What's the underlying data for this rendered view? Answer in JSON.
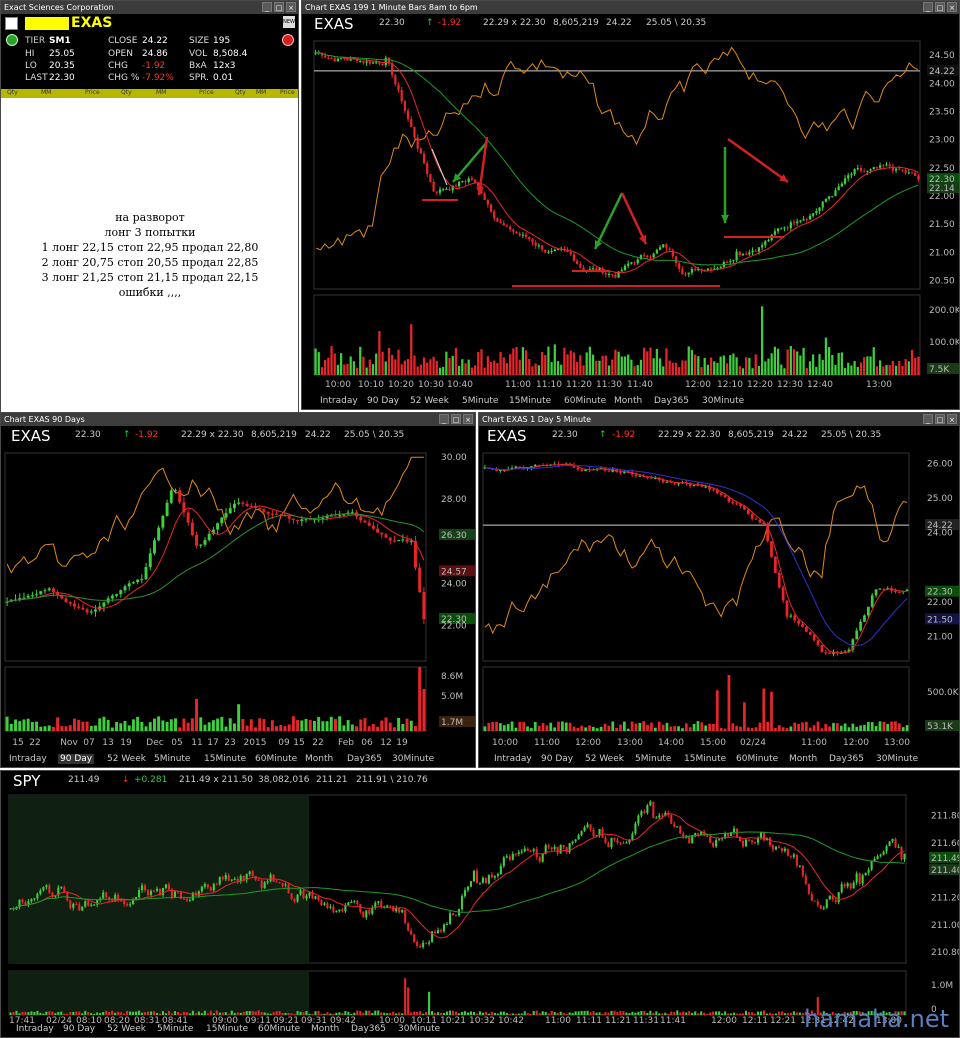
{
  "quote_window": {
    "title": "Exact Sciences Corporation",
    "symbol": "EXAS",
    "fields": {
      "tier_label": "TIER",
      "tier": "SM1",
      "hi_label": "HI",
      "hi": "25.05",
      "lo_label": "LO",
      "lo": "20.35",
      "last_label": "LAST",
      "last": "22.30",
      "close_label": "CLOSE",
      "close": "24.22",
      "open_label": "OPEN",
      "open": "24.86",
      "chg_label": "CHG",
      "chg": "-1.92",
      "chgp_label": "CHG %",
      "chgp": "-7.92%",
      "size_label": "SIZE",
      "size": "195",
      "vol_label": "VOL",
      "vol": "8,508.4",
      "bxa_label": "BxA",
      "bxa": "12x3",
      "spr_label": "SPR.",
      "spr": "0.01"
    },
    "columns": [
      "Qty",
      "MM",
      "Price",
      "Qty",
      "MM",
      "Price",
      "Qty",
      "MM",
      "Price"
    ],
    "notes": [
      "на разворот",
      "лонг  3  попытки",
      "1 лонг 22,15 стоп 22,95 продал 22,80",
      "2 лонг 20,75 стоп 20,55 продал 22,85",
      "3 лонг 21,25 стоп 21,15 продал 22,15",
      "ошибки ,,,,"
    ]
  },
  "chart_1min": {
    "title": "Chart EXAS 199 1 Minute Bars 8am to 6pm",
    "symbol": "EXAS",
    "last": "22.30",
    "change": "-1.92",
    "bid_ask": "22.29 x 22.30",
    "volume": "8,605,219",
    "close": "24.22",
    "hilo": "25.05 \\ 20.35",
    "price_ticks": [
      "24.50",
      "24.00",
      "23.50",
      "23.00",
      "22.50",
      "22.00",
      "21.50",
      "21.00",
      "20.50"
    ],
    "tag_close": "24.22",
    "tag_last": "22.30",
    "tag_ma": "22.14",
    "vol_ticks": [
      "200.0K",
      "100.0K"
    ],
    "vol_tag": "7.5K",
    "time_ticks": [
      "10:00",
      "10:10",
      "10:20",
      "10:30",
      "10:40",
      "11:00",
      "11:10",
      "11:20",
      "11:30",
      "11:40",
      "12:00",
      "12:10",
      "12:20",
      "12:30",
      "12:40",
      "13:00"
    ],
    "timeframes": [
      "Intraday",
      "90 Day",
      "52 Week",
      "5Minute",
      "15Minute",
      "60Minute",
      "Month",
      "Day365",
      "30Minute"
    ],
    "colors": {
      "up": "#3ecf3e",
      "down": "#e8262a",
      "ma_red": "#e8262a",
      "ma_green": "#1f9a2a",
      "osc": "#e08a10",
      "arrow_green": "#2aa02a",
      "arrow_red": "#d52020"
    }
  },
  "chart_90day": {
    "title": "Chart EXAS 90 Days",
    "symbol": "EXAS",
    "last": "22.30",
    "change": "-1.92",
    "bid_ask": "22.29 x 22.30",
    "volume": "8,605,219",
    "close": "24.22",
    "hilo": "25.05 \\ 20.35",
    "price_ticks": [
      "30.00",
      "28.00",
      "26.30",
      "24.57",
      "24.00",
      "22.30",
      "22.00"
    ],
    "vol_ticks": [
      "8.6M",
      "5.0M",
      "1.7M"
    ],
    "time_ticks": [
      "15",
      "22",
      "Nov",
      "07",
      "13",
      "19",
      "Dec",
      "05",
      "11",
      "17",
      "23",
      "2015",
      "09",
      "15",
      "22",
      "Feb",
      "06",
      "12",
      "19"
    ],
    "timeframes": [
      "Intraday",
      "90 Day",
      "52 Week",
      "5Minute",
      "15Minute",
      "60Minute",
      "Month",
      "Day365",
      "30Minute"
    ],
    "selected_timeframe": "90 Day"
  },
  "chart_5min": {
    "title": "Chart EXAS 1 Day 5 Minute",
    "symbol": "EXAS",
    "last": "22.30",
    "change": "-1.92",
    "bid_ask": "22.29 x 22.30",
    "volume": "8,605,219",
    "close": "24.22",
    "hilo": "25.05 \\ 20.35",
    "price_ticks": [
      "26.00",
      "25.00",
      "24.22",
      "24.00",
      "22.30",
      "22.00",
      "21.50",
      "21.00"
    ],
    "vol_ticks": [
      "500.0K",
      "53.1K"
    ],
    "time_ticks": [
      "10:00",
      "11:00",
      "12:00",
      "13:00",
      "14:00",
      "15:00",
      "02/24",
      "11:00",
      "12:00",
      "13:00"
    ],
    "timeframes": [
      "Intraday",
      "90 Day",
      "52 Week",
      "5Minute",
      "15Minute",
      "60Minute",
      "Month",
      "Day365",
      "30Minute"
    ]
  },
  "chart_spy": {
    "symbol": "SPY",
    "last": "211.49",
    "change": "+0.281",
    "bid_ask": "211.49 x 211.50",
    "volume": "38,082,016",
    "close": "211.21",
    "hilo": "211.91 \\ 210.76",
    "price_ticks": [
      "211.80",
      "211.60",
      "211.49",
      "211.40",
      "211.20",
      "211.00",
      "210.80"
    ],
    "vol_ticks": [
      "1.0M",
      "0"
    ],
    "time_ticks": [
      "17:41",
      "02/24",
      "08:10",
      "08:20",
      "08:31",
      "08:41",
      "09:00",
      "09:11",
      "09:21",
      "09:31",
      "09:42",
      "10:00",
      "10:11",
      "10:21",
      "10:32",
      "10:42",
      "11:00",
      "11:11",
      "11:21",
      "11:31",
      "11:41",
      "12:00",
      "12:11",
      "12:21",
      "12:31",
      "12:42",
      "13:00"
    ],
    "timeframes": [
      "Intraday",
      "90 Day",
      "52 Week",
      "5Minute",
      "15Minute",
      "60Minute",
      "Month",
      "Day365",
      "30Minute"
    ]
  },
  "watermark": "hamaha.net"
}
